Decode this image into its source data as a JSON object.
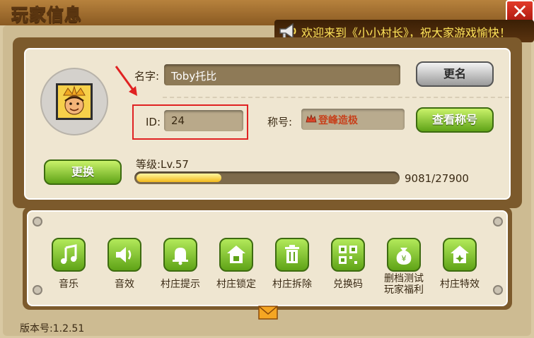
{
  "window": {
    "title": "玩家信息",
    "close_label": "✕"
  },
  "announcement": {
    "text": "欢迎来到《小小村长》，祝大家游戏愉快！"
  },
  "profile": {
    "name_label": "名字:",
    "name_value": "Toby托比",
    "rename_button": "更名",
    "id_label": "ID:",
    "id_value": "24",
    "title_label": "称号:",
    "title_value": "登峰造极",
    "view_titles_button": "查看称号",
    "change_avatar_button": "更换",
    "level_text": "等级:Lv.57",
    "xp_text": "9081/27900",
    "xp_current": 9081,
    "xp_max": 27900
  },
  "tools": [
    {
      "label": "音乐",
      "icon": "music-note-icon"
    },
    {
      "label": "音效",
      "icon": "speaker-icon"
    },
    {
      "label": "村庄提示",
      "icon": "bell-icon"
    },
    {
      "label": "村庄锁定",
      "icon": "house-lock-icon"
    },
    {
      "label": "村庄拆除",
      "icon": "trash-icon"
    },
    {
      "label": "兑换码",
      "icon": "qr-code-icon"
    },
    {
      "label": "删档测试\n玩家福利",
      "icon": "money-bag-icon"
    },
    {
      "label": "村庄特效",
      "icon": "house-sparkle-icon"
    }
  ],
  "footer": {
    "version": "版本号:1.2.51"
  },
  "colors": {
    "accent_green": "#5fa317",
    "highlight_red": "#e02222",
    "announce_yellow": "#ffe55a"
  }
}
